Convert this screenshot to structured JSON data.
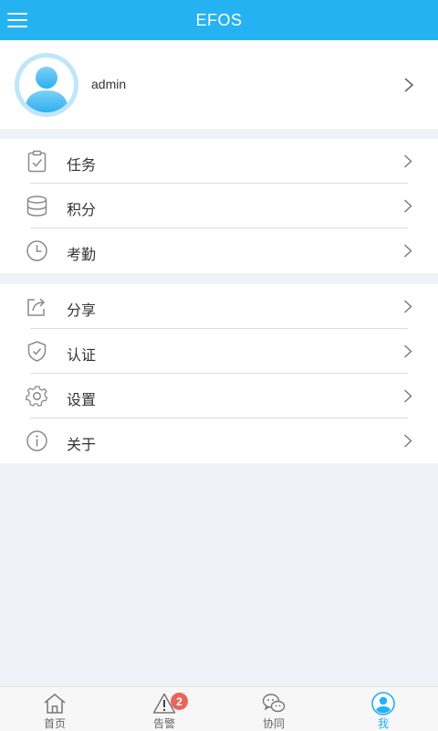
{
  "header": {
    "title": "EFOS",
    "menu_icon": "hamburger-menu-icon"
  },
  "profile": {
    "username": "admin",
    "avatar_icon": "user-avatar-icon"
  },
  "menu_groups": [
    [
      {
        "label": "任务",
        "icon": "clipboard-check-icon"
      },
      {
        "label": "积分",
        "icon": "database-icon"
      },
      {
        "label": "考勤",
        "icon": "clock-icon"
      }
    ],
    [
      {
        "label": "分享",
        "icon": "share-icon"
      },
      {
        "label": "认证",
        "icon": "shield-check-icon"
      },
      {
        "label": "设置",
        "icon": "gear-icon"
      },
      {
        "label": "关于",
        "icon": "info-icon"
      }
    ]
  ],
  "tabbar": {
    "tabs": [
      {
        "label": "首页",
        "icon": "home-icon"
      },
      {
        "label": "告警",
        "icon": "warning-icon",
        "badge": "2"
      },
      {
        "label": "协同",
        "icon": "chat-icon"
      },
      {
        "label": "我",
        "icon": "user-icon",
        "active": true
      }
    ]
  },
  "colors": {
    "accent": "#24b2f2",
    "badge": "#e8655a",
    "background": "#eff3f7",
    "icon": "#8a8a8a"
  }
}
